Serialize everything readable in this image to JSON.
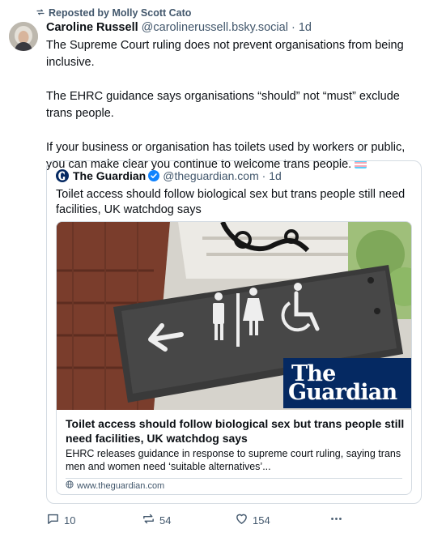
{
  "repost": {
    "text": "Reposted by Molly Scott Cato",
    "icon": "repost-icon"
  },
  "post": {
    "author_name": "Caroline Russell",
    "author_handle": "@carolinerussell.bsky.social",
    "separator": "·",
    "time": "1d",
    "paragraphs": [
      "The Supreme Court ruling does not prevent organisations from being inclusive.",
      "The EHRC guidance says organisations “should” not “must” exclude trans people.",
      "If your business or organisation has toilets used by workers or public, you can make clear you continue to welcome trans people."
    ],
    "flag_colors": [
      "#5bcefa",
      "#f5a9b8",
      "#ffffff",
      "#f5a9b8",
      "#5bcefa"
    ]
  },
  "quote": {
    "author_name": "The Guardian",
    "author_handle": "@theguardian.com",
    "separator": "·",
    "time": "1d",
    "text": "Toilet access should follow biological sex but trans people still need facilities, UK watchdog says",
    "link_card": {
      "badge_line1": "The",
      "badge_line2": "Guardian",
      "title": "Toilet access should follow biological sex but trans people still need facilities, UK watchdog says",
      "description": "EHRC releases guidance in response to supreme court ruling, saying trans men and women need ‘suitable alternatives’...",
      "domain": "www.theguardian.com"
    }
  },
  "actions": {
    "reply_count": "10",
    "repost_count": "54",
    "like_count": "154"
  },
  "colors": {
    "accent": "#1083fe",
    "muted": "#42576c",
    "guardian_blue": "#052962"
  }
}
